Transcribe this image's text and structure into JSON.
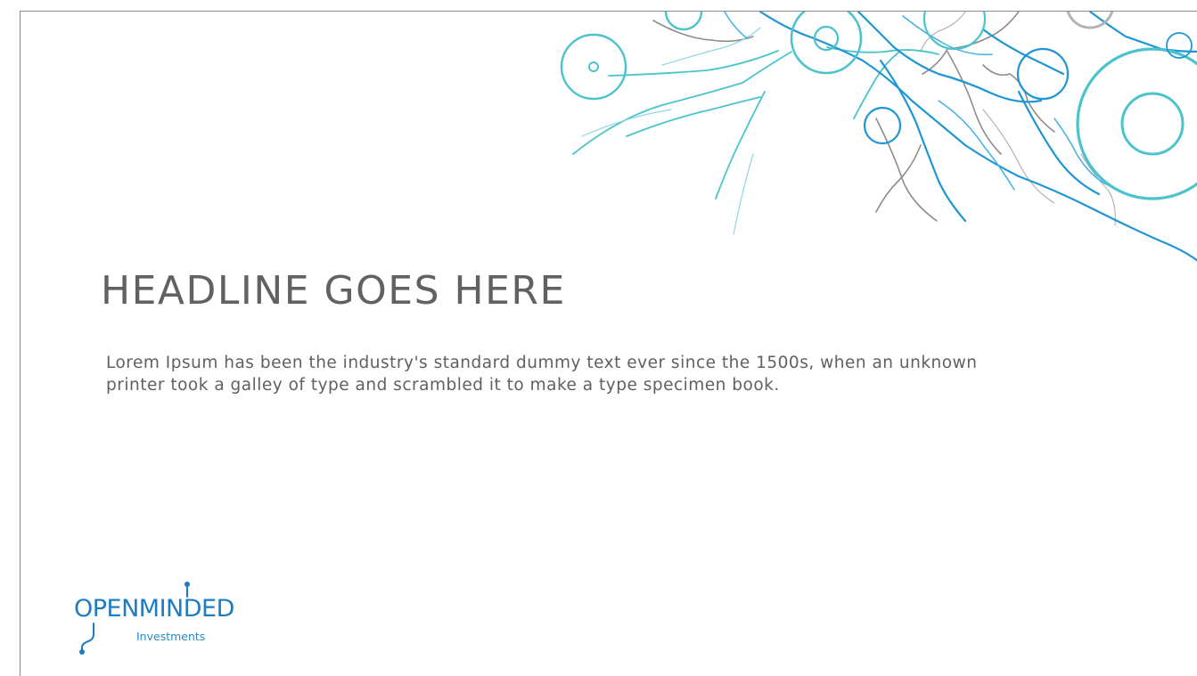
{
  "slide": {
    "headline": "HEADLINE GOES HERE",
    "body": "Lorem Ipsum has been the industry's standard dummy text ever since the 1500s, when an unknown printer took a galley of type and scrambled it to make a type specimen book."
  },
  "logo": {
    "wordmark": "OPENMINDED",
    "tagline": "Investments",
    "icon": "circuit-node-icon"
  },
  "decoration": {
    "icon": "neural-circuit-illustration"
  },
  "colors": {
    "headline": "#616161",
    "body": "#606060",
    "accent_blue": "#1e96d6",
    "accent_teal": "#4cc3cc",
    "accent_gray": "#8c8c8c",
    "logo_blue": "#1e7cc0",
    "frame": "#8a8a8a"
  }
}
